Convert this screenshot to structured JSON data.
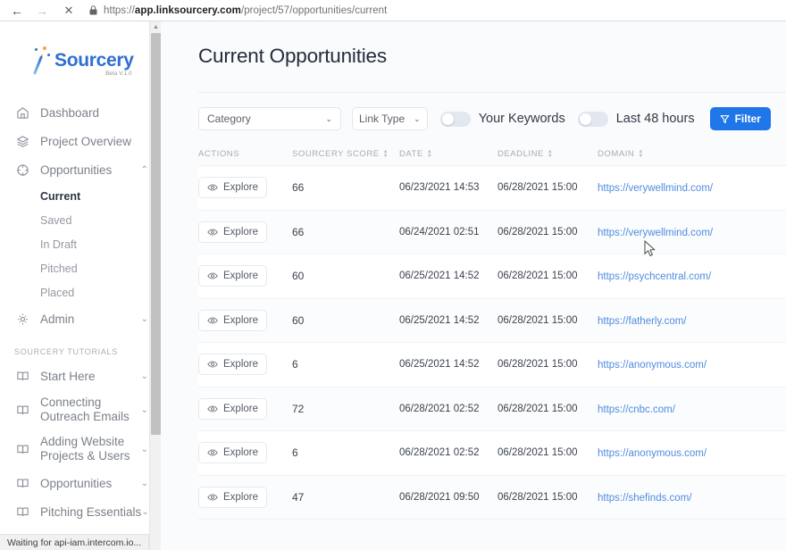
{
  "browser": {
    "back_icon": "arrow-left-icon",
    "forward_icon": "arrow-right-icon",
    "stop_icon": "close-icon",
    "lock_icon": "lock-icon",
    "url_domain": "app.linksourcery.com",
    "url_prefix": "https://",
    "url_path": "/project/57/opportunities/current",
    "status_text": "Waiting for api-iam.intercom.io..."
  },
  "sidebar": {
    "logo_text": "Sourcery",
    "logo_beta": "Beta V.1.0",
    "nav": [
      {
        "label": "Dashboard",
        "icon": "home-icon",
        "chevron": ""
      },
      {
        "label": "Project Overview",
        "icon": "layers-icon",
        "chevron": ""
      },
      {
        "label": "Opportunities",
        "icon": "target-icon",
        "chevron": "⌃"
      }
    ],
    "sub_items": [
      {
        "label": "Current",
        "active": true
      },
      {
        "label": "Saved",
        "active": false
      },
      {
        "label": "In Draft",
        "active": false
      },
      {
        "label": "Pitched",
        "active": false
      },
      {
        "label": "Placed",
        "active": false
      }
    ],
    "admin": {
      "label": "Admin",
      "icon": "gear-icon",
      "chevron": "⌄"
    },
    "tutorials_label": "SOURCERY TUTORIALS",
    "tutorials": [
      {
        "label": "Start Here",
        "icon": "book-icon",
        "chevron": "⌄"
      },
      {
        "label": "Connecting Outreach Emails",
        "icon": "book-icon",
        "chevron": "⌄"
      },
      {
        "label": "Adding Website Projects & Users",
        "icon": "book-icon",
        "chevron": "⌄"
      },
      {
        "label": "Opportunities",
        "icon": "book-icon",
        "chevron": "⌄"
      },
      {
        "label": "Pitching Essentials",
        "icon": "book-icon",
        "chevron": "⌄"
      }
    ]
  },
  "main": {
    "page_title": "Current Opportunities",
    "toolbar": {
      "category_label": "Category",
      "category_chevron": "⌄",
      "link_type_label": "Link Type",
      "link_type_chevron": "⌄",
      "keywords_toggle_label": "Your Keywords",
      "keywords_toggle_on": false,
      "last48_toggle_label": "Last 48 hours",
      "last48_toggle_on": false,
      "filter_label": "Filter",
      "filter_icon": "funnel-icon",
      "filter_color": "#1f76e8"
    },
    "table": {
      "headers": [
        {
          "label": "Actions",
          "sortable": false
        },
        {
          "label": "Sourcery Score",
          "sortable": true
        },
        {
          "label": "Date",
          "sortable": true
        },
        {
          "label": "Deadline",
          "sortable": true
        },
        {
          "label": "Domain",
          "sortable": true
        }
      ],
      "action_label": "Explore",
      "action_icon": "eye-icon",
      "rows": [
        {
          "score": "66",
          "date": "06/23/2021 14:53",
          "deadline": "06/28/2021 15:00",
          "domain": "https://verywellmind.com/"
        },
        {
          "score": "66",
          "date": "06/24/2021 02:51",
          "deadline": "06/28/2021 15:00",
          "domain": "https://verywellmind.com/"
        },
        {
          "score": "60",
          "date": "06/25/2021 14:52",
          "deadline": "06/28/2021 15:00",
          "domain": "https://psychcentral.com/"
        },
        {
          "score": "60",
          "date": "06/25/2021 14:52",
          "deadline": "06/28/2021 15:00",
          "domain": "https://fatherly.com/"
        },
        {
          "score": "6",
          "date": "06/25/2021 14:52",
          "deadline": "06/28/2021 15:00",
          "domain": "https://anonymous.com/"
        },
        {
          "score": "72",
          "date": "06/28/2021 02:52",
          "deadline": "06/28/2021 15:00",
          "domain": "https://cnbc.com/"
        },
        {
          "score": "6",
          "date": "06/28/2021 02:52",
          "deadline": "06/28/2021 15:00",
          "domain": "https://anonymous.com/"
        },
        {
          "score": "47",
          "date": "06/28/2021 09:50",
          "deadline": "06/28/2021 15:00",
          "domain": "https://shefinds.com/"
        }
      ]
    }
  }
}
